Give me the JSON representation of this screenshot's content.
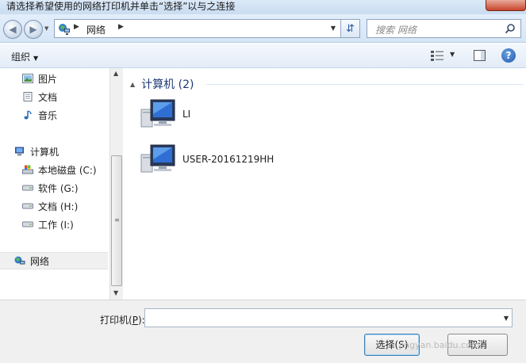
{
  "window": {
    "title": "请选择希望使用的网络打印机并单击“选择”以与之连接"
  },
  "address_bar": {
    "path": "网络"
  },
  "search": {
    "placeholder": "搜索 网络"
  },
  "toolbar": {
    "organize_label": "组织"
  },
  "nav_pane": {
    "items": [
      {
        "label": "图片",
        "icon": "pictures-icon"
      },
      {
        "label": "文档",
        "icon": "documents-icon"
      },
      {
        "label": "音乐",
        "icon": "music-icon"
      },
      {
        "label": "计算机",
        "icon": "computer-icon"
      },
      {
        "label": "本地磁盘 (C:)",
        "icon": "local-disk-icon"
      },
      {
        "label": "软件 (G:)",
        "icon": "drive-icon"
      },
      {
        "label": "文档 (H:)",
        "icon": "drive-icon"
      },
      {
        "label": "工作 (I:)",
        "icon": "drive-icon"
      },
      {
        "label": "网络",
        "icon": "network-icon"
      }
    ]
  },
  "content": {
    "group_title": "计算机 (2)",
    "computers": [
      {
        "name": "LI"
      },
      {
        "name": "USER-20161219HH"
      }
    ]
  },
  "bottom": {
    "printer_label": "打印机(",
    "printer_hotkey": "P",
    "printer_label_end": "):",
    "printer_value": "",
    "select_button": "选择(S)",
    "cancel_button": "取消"
  },
  "watermark": "jingyan.baidu.com",
  "colors": {
    "accent": "#1e3a78",
    "close": "#c7442c",
    "chrome": "#dce9f7"
  }
}
